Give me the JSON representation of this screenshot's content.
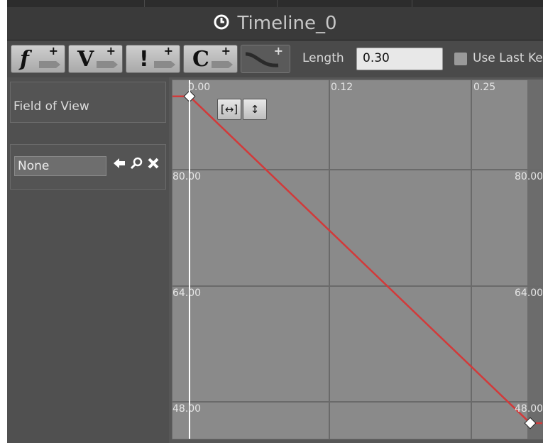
{
  "title_bar": {
    "title": "Timeline_0",
    "clock_icon": "clock-icon"
  },
  "toolbar": {
    "buttons": [
      {
        "letter": "f",
        "plus": "+",
        "icon": "add-float-track-icon"
      },
      {
        "letter": "V",
        "plus": "+",
        "icon": "add-vector-track-icon"
      },
      {
        "letter": "!",
        "plus": "+",
        "icon": "add-event-track-icon"
      },
      {
        "letter": "C",
        "plus": "+",
        "icon": "add-color-track-icon"
      },
      {
        "letter": "",
        "plus": "+",
        "icon": "add-external-curve-icon"
      }
    ],
    "length_label": "Length",
    "length_value": "0.30",
    "use_last_key_label": "Use Last Ke"
  },
  "track_panel": {
    "track_name": "Field of View",
    "curve_asset": "None",
    "icons": [
      "use-selected-arrow-icon",
      "browse-magnifier-icon",
      "clear-x-icon"
    ]
  },
  "graph": {
    "x_ticks": [
      "0.00",
      "0.12",
      "0.25"
    ],
    "y_ticks_left": [
      "80.00",
      "64.00",
      "48.00"
    ],
    "y_ticks_right": [
      "80.00",
      "64.00",
      "48.00"
    ],
    "fit_horizontal_label": "[↔]",
    "fit_vertical_label": "↕",
    "curve_color": "#d23a3a",
    "cursor_color": "#ffffff",
    "keys": [
      {
        "time": 0.0,
        "value": 90.0
      },
      {
        "time": 0.3,
        "value": 45.0
      }
    ]
  }
}
